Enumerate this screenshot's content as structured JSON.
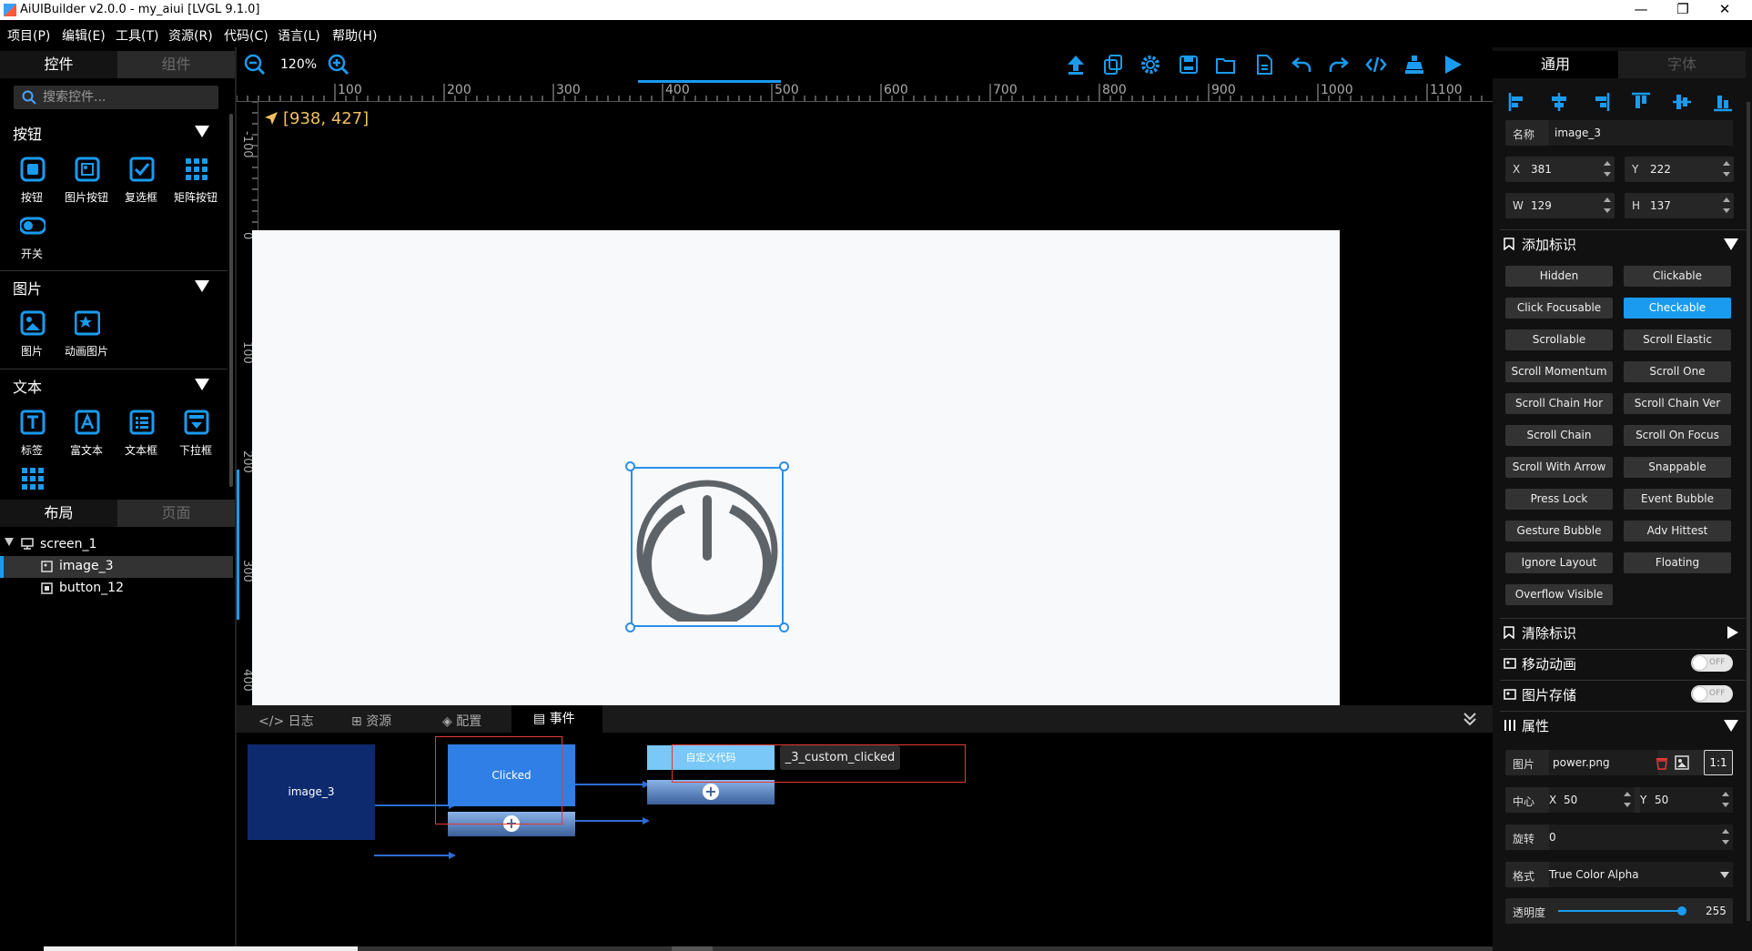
{
  "window": {
    "title": "AiUIBuilder v2.0.0 - my_aiui [LVGL 9.1.0]",
    "minimize": "—",
    "restore": "❐",
    "close": "✕"
  },
  "menu": [
    "项目(P)",
    "编辑(E)",
    "工具(T)",
    "资源(R)",
    "代码(C)",
    "语言(L)",
    "帮助(H)"
  ],
  "left_tabs": {
    "controls": "控件",
    "components": "组件"
  },
  "search": {
    "placeholder": "搜索控件..."
  },
  "sections": {
    "buttons": {
      "title": "按钮",
      "items": [
        "按钮",
        "图片按钮",
        "复选框",
        "矩阵按钮",
        "开关"
      ]
    },
    "images": {
      "title": "图片",
      "items": [
        "图片",
        "动画图片"
      ]
    },
    "text": {
      "title": "文本",
      "items": [
        "标签",
        "富文本",
        "文本框",
        "下拉框"
      ]
    }
  },
  "layout_tabs": {
    "layout": "布局",
    "page": "页面"
  },
  "tree": {
    "root": "screen_1",
    "children": [
      "image_3",
      "button_12"
    ]
  },
  "zoom": {
    "level": "120%"
  },
  "cursor_readout": "[938, 427]",
  "ruler": {
    "h_labels": [
      "100",
      "200",
      "300",
      "400",
      "500",
      "600",
      "700",
      "800",
      "900",
      "1000",
      "1100"
    ],
    "v_labels": [
      "-100",
      "0",
      "100",
      "200",
      "300",
      "400"
    ]
  },
  "bottom_tabs": [
    "日志",
    "资源",
    "配置",
    "事件"
  ],
  "events": {
    "node_image": "image_3",
    "node_event": "Clicked",
    "node_action": "自定义代码",
    "callback": "_3_custom_clicked",
    "add_symbol": "+"
  },
  "right_tabs": {
    "general": "通用",
    "font": "字体"
  },
  "props": {
    "name_label": "名称",
    "name_value": "image_3",
    "x_label": "X",
    "x_value": "381",
    "y_label": "Y",
    "y_value": "222",
    "w_label": "W",
    "w_value": "129",
    "h_label": "H",
    "h_value": "137"
  },
  "flags": {
    "add_title": "添加标识",
    "items": [
      "Hidden",
      "Clickable",
      "Click Focusable",
      "Checkable",
      "Scrollable",
      "Scroll Elastic",
      "Scroll Momentum",
      "Scroll One",
      "Scroll Chain Hor",
      "Scroll Chain Ver",
      "Scroll Chain",
      "Scroll On Focus",
      "Scroll With Arrow",
      "Snappable",
      "Press Lock",
      "Event Bubble",
      "Gesture Bubble",
      "Adv Hittest",
      "Ignore Layout",
      "Floating",
      "Overflow Visible"
    ],
    "active": "Checkable",
    "clear_title": "清除标识"
  },
  "move_anim": {
    "title": "移动动画",
    "state": "OFF"
  },
  "img_store": {
    "title": "图片存储",
    "state": "OFF"
  },
  "attrs": {
    "title": "属性",
    "image_label": "图片",
    "image_value": "power.png",
    "ratio": "1:1",
    "center_label": "中心",
    "cx_label": "X",
    "cx_value": "50",
    "cy_label": "Y",
    "cy_value": "50",
    "rotate_label": "旋转",
    "rotate_value": "0",
    "format_label": "格式",
    "format_value": "True Color Alpha",
    "opacity_label": "透明度",
    "opacity_value": "255",
    "opacity_fraction": 0.97
  },
  "colors": {
    "accent": "#1a9bf0",
    "node_dark": "#0d2a6e",
    "node_blue": "#2f7fe6",
    "node_light": "#79c8f7",
    "selection": "#2d8ee8",
    "warn": "#e53935"
  }
}
